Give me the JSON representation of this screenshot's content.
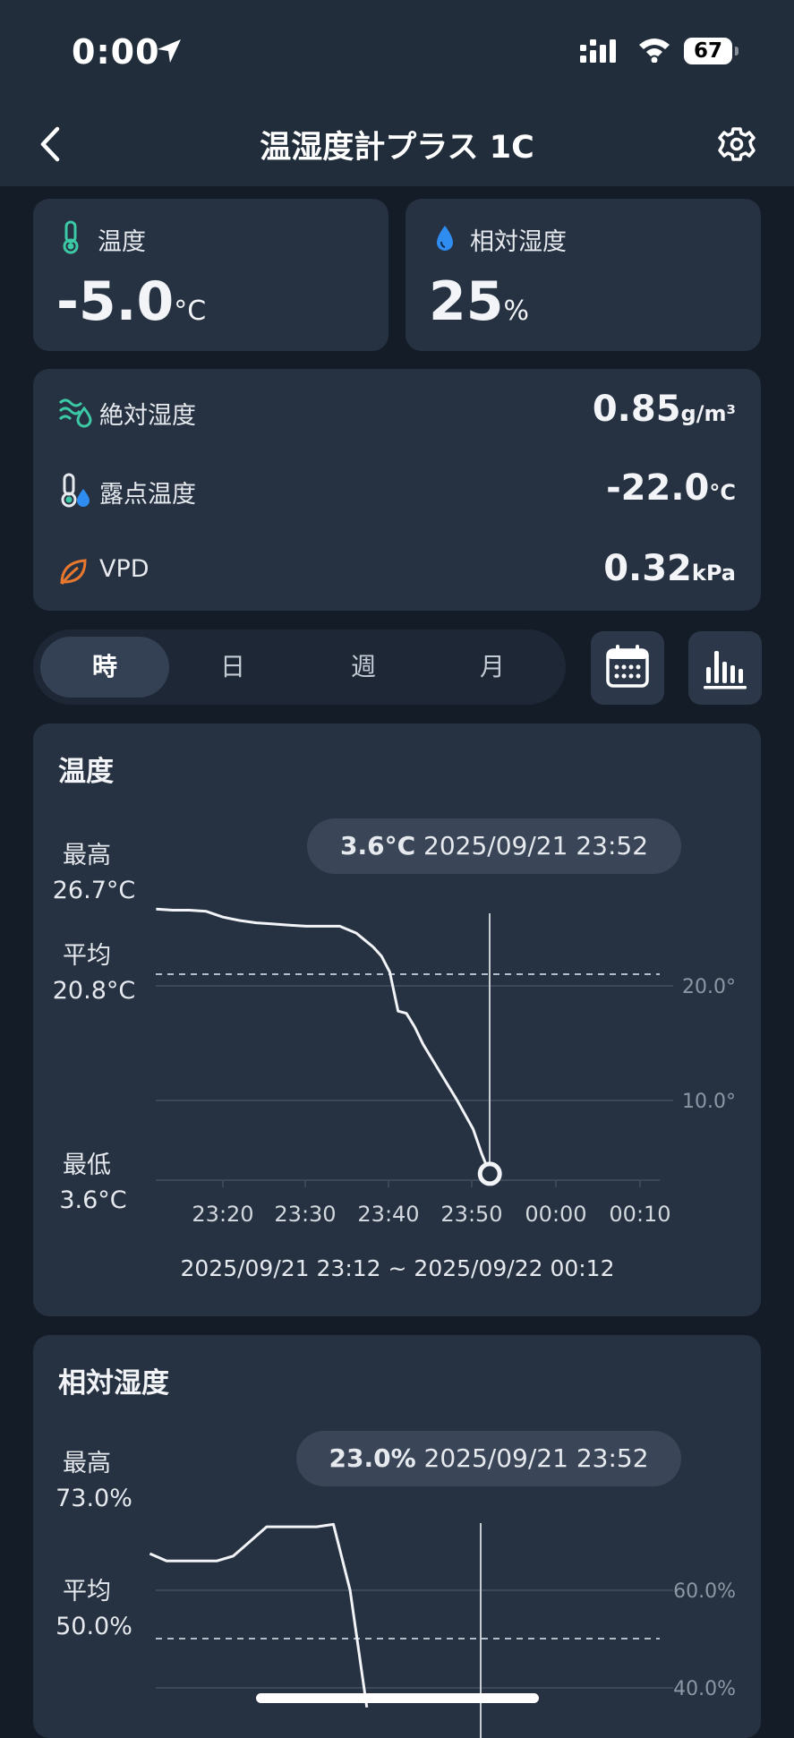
{
  "status": {
    "time": "0:00",
    "battery": "67"
  },
  "nav": {
    "title": "温湿度計プラス 1C"
  },
  "temp_card": {
    "label": "温度",
    "value": "-5.0",
    "unit": "°C"
  },
  "hum_card": {
    "label": "相対湿度",
    "value": "25",
    "unit": "%"
  },
  "metrics": [
    {
      "label": "絶対湿度",
      "value": "0.85",
      "unit": "g/m³",
      "icon": "wave-drop-icon"
    },
    {
      "label": "露点温度",
      "value": "-22.0",
      "unit": "°C",
      "icon": "thermo-drop-icon"
    },
    {
      "label": "VPD",
      "value": "0.32",
      "unit": "kPa",
      "icon": "leaf-icon"
    }
  ],
  "tabs": [
    "時",
    "日",
    "週",
    "月"
  ],
  "selected_tab": "時",
  "icons": {
    "calendar": "calendar-icon",
    "bars": "bar-chart-icon",
    "settings": "gear-icon",
    "back": "chevron-left-icon"
  },
  "colors": {
    "accent_teal": "#3cc9a6",
    "accent_blue": "#2f8cf0",
    "accent_orange": "#e8782e",
    "card": "#263242"
  },
  "temp_chart": {
    "title": "温度",
    "max_label": "最高",
    "max_value": "26.7°C",
    "avg_label": "平均",
    "avg_value": "20.8°C",
    "min_label": "最低",
    "min_value": "3.6°C",
    "tooltip_value": "3.6°C",
    "tooltip_time": "2025/09/21 23:52",
    "range": "2025/09/21 23:12 ~ 2025/09/22 00:12",
    "x_ticks": [
      "23:20",
      "23:30",
      "23:40",
      "23:50",
      "00:00",
      "00:10"
    ],
    "y_ticks": [
      "20.0°",
      "10.0°"
    ]
  },
  "hum_chart": {
    "title": "相対湿度",
    "max_label": "最高",
    "max_value": "73.0%",
    "avg_label": "平均",
    "avg_value": "50.0%",
    "tooltip_value": "23.0%",
    "tooltip_time": "2025/09/21 23:52",
    "y_ticks": [
      "60.0%",
      "40.0%"
    ]
  },
  "chart_data": [
    {
      "type": "line",
      "title": "温度",
      "x": [
        "23:12",
        "23:14",
        "23:16",
        "23:18",
        "23:20",
        "23:22",
        "23:24",
        "23:26",
        "23:28",
        "23:30",
        "23:32",
        "23:34",
        "23:36",
        "23:37",
        "23:38",
        "23:39",
        "23:40",
        "23:41",
        "23:42",
        "23:43",
        "23:44",
        "23:46",
        "23:48",
        "23:50",
        "23:51",
        "23:52"
      ],
      "series": [
        {
          "values": [
            26.7,
            26.6,
            26.6,
            26.5,
            26.0,
            25.7,
            25.5,
            25.4,
            25.3,
            25.2,
            25.2,
            25.2,
            24.6,
            24.0,
            23.4,
            22.6,
            21.2,
            17.8,
            17.6,
            16.4,
            14.9,
            12.5,
            10.1,
            7.5,
            5.4,
            3.6
          ]
        }
      ],
      "xlabel": "",
      "ylabel": "",
      "ylim": [
        3.6,
        27
      ],
      "y_ticks": [
        10.0,
        20.0
      ],
      "average": 20.8,
      "cursor_x": "23:52",
      "cursor_value": 3.6,
      "grid": true
    },
    {
      "type": "line",
      "title": "相対湿度",
      "x": [
        "23:12",
        "23:14",
        "23:16",
        "23:18",
        "23:20",
        "23:22",
        "23:24",
        "23:26",
        "23:28",
        "23:30",
        "23:32",
        "23:34",
        "23:36",
        "23:38"
      ],
      "series": [
        {
          "values": [
            67.5,
            66.0,
            66.0,
            66.0,
            66.0,
            67.0,
            70.0,
            73.0,
            73.0,
            73.0,
            73.0,
            73.5,
            60.0,
            36.0
          ]
        }
      ],
      "xlabel": "",
      "ylabel": "",
      "y_ticks": [
        40.0,
        60.0
      ],
      "average": 50.0,
      "grid": true
    }
  ]
}
